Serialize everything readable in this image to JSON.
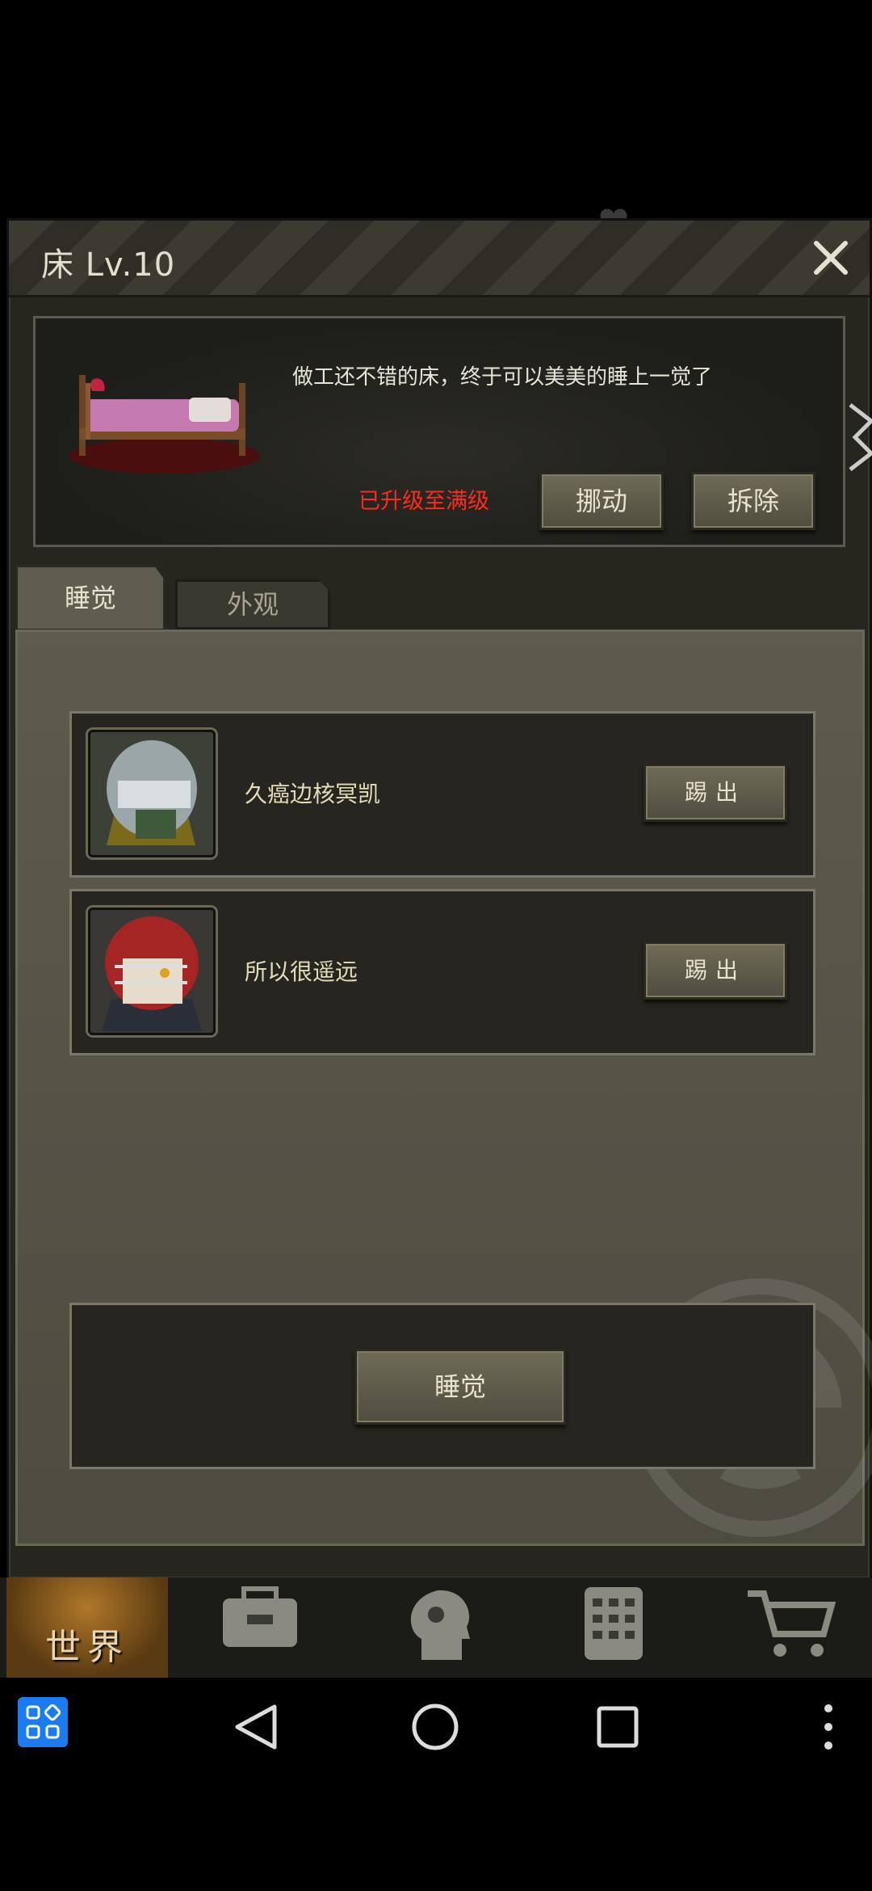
{
  "dialog": {
    "title": "床 Lv.10",
    "description": "做工还不错的床，终于可以美美的睡上一觉了",
    "max_status": "已升级至满级",
    "move_label": "挪动",
    "remove_label": "拆除"
  },
  "tabs": [
    {
      "label": "睡觉",
      "active": true
    },
    {
      "label": "外观",
      "active": false
    }
  ],
  "sleepers": [
    {
      "name": "久癌边核冥凯",
      "kick_label": "踢出"
    },
    {
      "name": "所以很遥远",
      "kick_label": "踢出"
    }
  ],
  "sleep_button": "睡觉",
  "bottom_nav": {
    "world_label": "世界"
  },
  "colors": {
    "accent_red": "#ff2a1e",
    "system_button_blue": "#1a7cf0"
  }
}
